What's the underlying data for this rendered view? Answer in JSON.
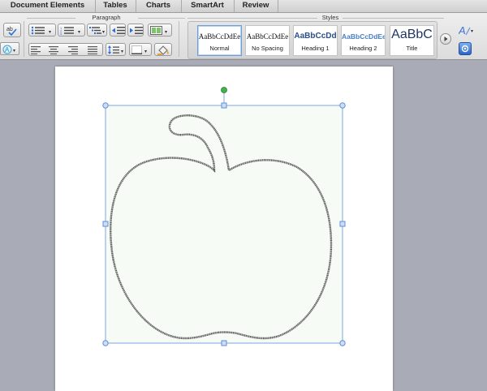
{
  "tabs": [
    {
      "label": "Document Elements"
    },
    {
      "label": "Tables"
    },
    {
      "label": "Charts"
    },
    {
      "label": "SmartArt"
    },
    {
      "label": "Review"
    }
  ],
  "ribbon": {
    "groups": {
      "paragraph": "Paragraph",
      "styles": "Styles"
    },
    "styles": [
      {
        "sample": "AaBbCcDdEe",
        "name": "Normal",
        "active": true
      },
      {
        "sample": "AaBbCcDdEe",
        "name": "No Spacing",
        "active": false
      },
      {
        "sample": "AaBbCcDd",
        "name": "Heading 1",
        "active": false
      },
      {
        "sample": "AaBbCcDdEe",
        "name": "Heading 2",
        "active": false
      },
      {
        "sample": "AaBbC",
        "name": "Title",
        "active": false
      }
    ]
  },
  "colors": {
    "selection": "#5b8fd8",
    "rotate_handle": "#3fb24a",
    "shape_fill": "#f6fbf5",
    "shape_stroke": "#444444"
  },
  "document": {
    "shape": {
      "type": "apple-outline",
      "selected": true
    }
  }
}
